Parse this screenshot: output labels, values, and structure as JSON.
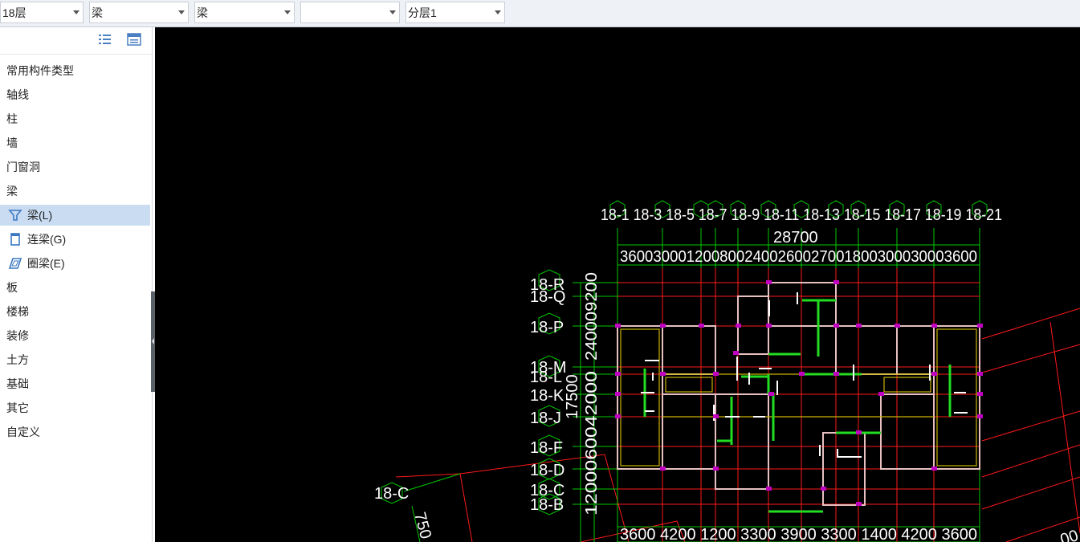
{
  "toolbar": {
    "floor_select": "18层",
    "category_select": "梁",
    "type_select": "梁",
    "component_select": "",
    "layer_select": "分层1"
  },
  "sidebar": {
    "items": [
      {
        "label": "常用构件类型"
      },
      {
        "label": "轴线"
      },
      {
        "label": "柱"
      },
      {
        "label": "墙"
      },
      {
        "label": "门窗洞"
      },
      {
        "label": "梁"
      },
      {
        "label": "梁(L)",
        "icon": "beam-icon",
        "selected": true
      },
      {
        "label": "连梁(G)",
        "icon": "coupling-beam-icon"
      },
      {
        "label": "圈梁(E)",
        "icon": "ring-beam-icon"
      },
      {
        "label": "板"
      },
      {
        "label": "楼梯"
      },
      {
        "label": "装修"
      },
      {
        "label": "土方"
      },
      {
        "label": "基础"
      },
      {
        "label": "其它"
      },
      {
        "label": "自定义"
      }
    ]
  },
  "drawing": {
    "top_axis_labels": [
      "18-1",
      "18-3",
      "18-5",
      "18-7",
      "18-9",
      "18-11",
      "18-13",
      "18-15",
      "18-17",
      "18-19",
      "18-21"
    ],
    "total_width_dim": "28700",
    "top_dims": [
      "3600",
      "3000",
      "1200",
      "800",
      "2400",
      "2600",
      "2700",
      "1800",
      "3000",
      "3000",
      "3600"
    ],
    "bottom_dims": [
      "3600",
      "4200",
      "1200",
      "3300",
      "3900",
      "3300",
      "1400",
      "4200",
      "3600"
    ],
    "left_axis_labels": [
      "18-R",
      "18-Q",
      "18-P",
      "18-M",
      "18-L",
      "18-K",
      "18-J",
      "18-F",
      "18-D",
      "18-C",
      "18-B"
    ],
    "left_vertical_dim_upper": "240009200",
    "left_vertical_dim_total": "17500",
    "left_vertical_dim_lower": "1200060042000",
    "rotated_axis_label": "18-C",
    "rotated_dim": "750",
    "bottom_right_partial": "00",
    "colors": {
      "grid": "#00c800",
      "axis": "#ff1a1a",
      "beam": "#e8c0c0",
      "beam_green": "#22dd22",
      "joint": "#c000c0",
      "wall": "#ffffff",
      "text": "#ffffff"
    }
  }
}
